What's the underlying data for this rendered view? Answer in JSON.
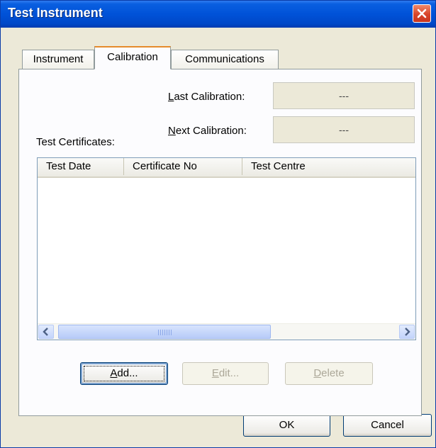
{
  "window": {
    "title": "Test Instrument"
  },
  "tabs": [
    {
      "label": "Instrument",
      "active": false
    },
    {
      "label": "Calibration",
      "active": true
    },
    {
      "label": "Communications",
      "active": false
    }
  ],
  "calibration": {
    "last_calibration": {
      "label_accel": "L",
      "label_rest": "ast Calibration:",
      "value": "---"
    },
    "next_calibration": {
      "label_accel": "N",
      "label_rest": "ext Calibration:",
      "value": "---"
    },
    "certificates_label": "Test Certificates:",
    "columns": [
      "Test Date",
      "Certificate No",
      "Test Centre"
    ],
    "rows": [],
    "add_button": {
      "accel": "A",
      "rest": "dd...",
      "enabled": true
    },
    "edit_button": {
      "accel": "E",
      "rest": "dit...",
      "enabled": false
    },
    "delete_button": {
      "accel": "D",
      "rest": "elete",
      "enabled": false
    }
  },
  "footer": {
    "ok_label": "OK",
    "cancel_label": "Cancel"
  },
  "colors": {
    "titlebar": "#0052d8",
    "dialog_bg": "#ece9d8",
    "active_tab_accent": "#e68b2c"
  },
  "icons": {
    "close": "close-icon",
    "scroll_left": "chevron-left-icon",
    "scroll_right": "chevron-right-icon"
  }
}
